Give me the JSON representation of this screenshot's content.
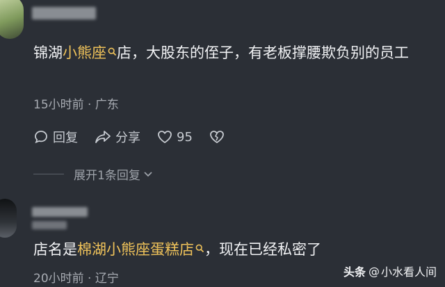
{
  "comment1": {
    "text_before": "锦湖",
    "highlight": "小熊座",
    "text_after": "店，大股东的侄子，有老板撑腰欺负别的员工",
    "meta": "15小时前 · 广东",
    "actions": {
      "reply": "回复",
      "share": "分享",
      "likes": "95"
    },
    "expand": "展开1条回复"
  },
  "comment2": {
    "text_before": "店名是",
    "highlight": "棉湖小熊座蛋糕店",
    "text_after": "，现在已经私密了",
    "meta": "20小时前 · 辽宁"
  },
  "watermark": {
    "brand": "头条",
    "at": "@",
    "account": "小水看人间"
  },
  "colors": {
    "background": "#2b2f36",
    "highlight": "#f0c35a",
    "meta": "#a8acb3"
  }
}
